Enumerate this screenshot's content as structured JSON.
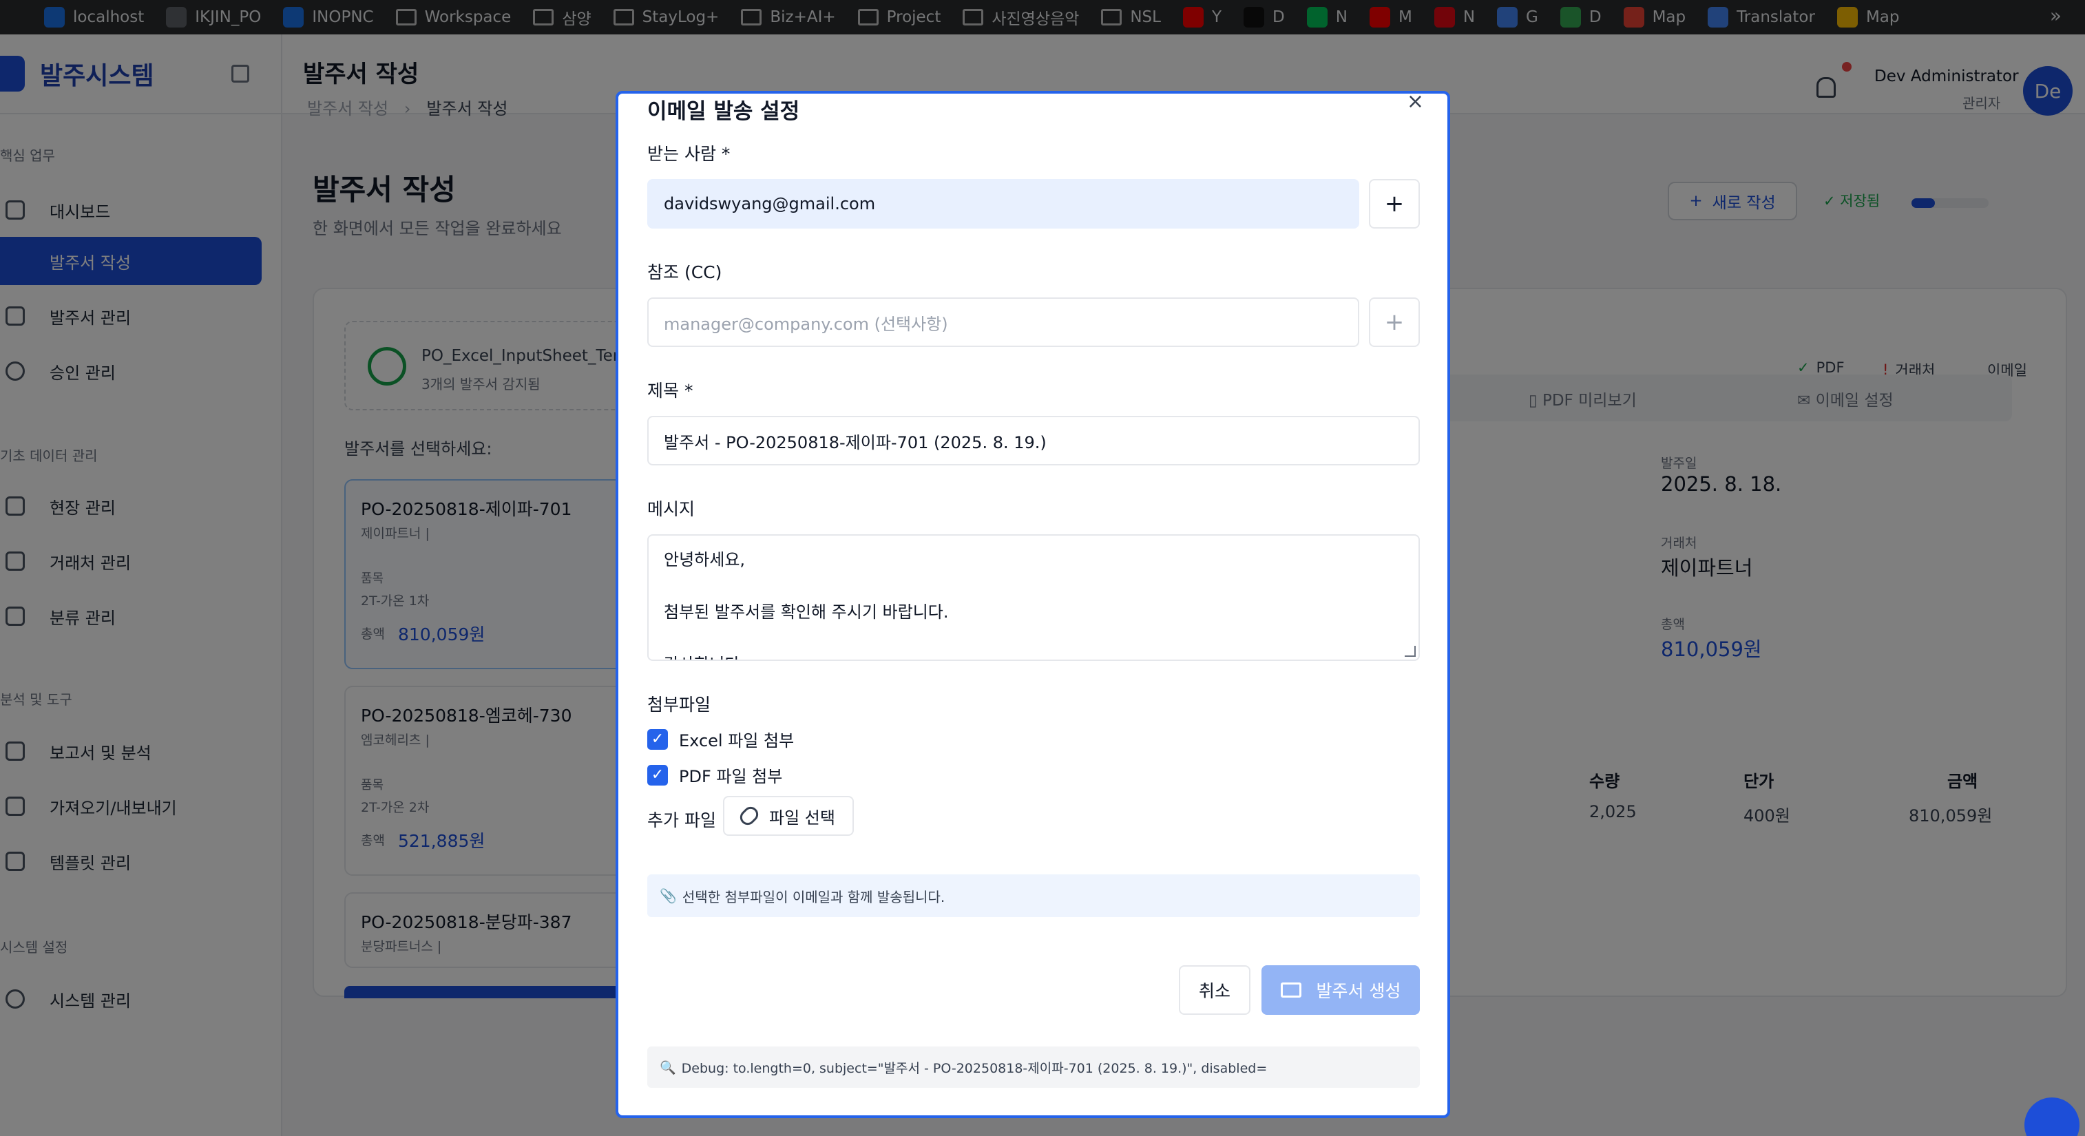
{
  "bookmarks": [
    {
      "label": "localhost",
      "icon": "globe-icon",
      "color": "#1a73e8"
    },
    {
      "label": "IKJIN_PO",
      "icon": "globe-icon",
      "color": "#5f6368"
    },
    {
      "label": "INOPNC",
      "icon": "globe-icon",
      "color": "#1a73e8"
    },
    {
      "label": "Workspace",
      "icon": "folder-icon"
    },
    {
      "label": "삼양",
      "icon": "folder-icon"
    },
    {
      "label": "StayLog+",
      "icon": "folder-icon"
    },
    {
      "label": "Biz+AI+",
      "icon": "folder-icon"
    },
    {
      "label": "Project",
      "icon": "folder-icon"
    },
    {
      "label": "사진영상음악",
      "icon": "folder-icon"
    },
    {
      "label": "NSL",
      "icon": "folder-icon"
    },
    {
      "label": "Y",
      "icon": "youtube-icon",
      "color": "#ff0000"
    },
    {
      "label": "D",
      "icon": "d-icon",
      "color": "#111111"
    },
    {
      "label": "N",
      "icon": "naver-icon",
      "color": "#03c75a"
    },
    {
      "label": "M",
      "icon": "youtube-music-icon",
      "color": "#ff0000"
    },
    {
      "label": "N",
      "icon": "netflix-icon",
      "color": "#e50914"
    },
    {
      "label": "G",
      "icon": "google-icon",
      "color": "#4285f4"
    },
    {
      "label": "D",
      "icon": "drive-icon",
      "color": "#34a853"
    },
    {
      "label": "Map",
      "icon": "google-maps-icon",
      "color": "#ea4335"
    },
    {
      "label": "Translator",
      "icon": "translate-icon",
      "color": "#4285f4"
    },
    {
      "label": "Map",
      "icon": "maps-icon",
      "color": "#fbbc04"
    }
  ],
  "bookmarks_more": "»",
  "sidebar": {
    "title": "발주시스템",
    "sections": [
      {
        "label": "핵심 업무",
        "top": 0
      },
      {
        "label": "기초 데이터 관리"
      },
      {
        "label": "분석 및 도구"
      },
      {
        "label": "시스템 설정"
      }
    ],
    "items": [
      {
        "label": "대시보드",
        "icon": "home-icon"
      },
      {
        "label": "발주서 작성",
        "icon": "plus-icon",
        "active": true
      },
      {
        "label": "발주서 관리",
        "icon": "document-icon"
      },
      {
        "label": "승인 관리",
        "icon": "check-circle-icon"
      },
      {
        "label": "현장 관리",
        "icon": "building-icon"
      },
      {
        "label": "거래처 관리",
        "icon": "building-2-icon"
      },
      {
        "label": "분류 관리",
        "icon": "tag-icon"
      },
      {
        "label": "보고서 및 분석",
        "icon": "bar-chart-icon"
      },
      {
        "label": "가져오기/내보내기",
        "icon": "file-import-icon"
      },
      {
        "label": "템플릿 관리",
        "icon": "template-icon"
      },
      {
        "label": "시스템 관리",
        "icon": "gear-icon"
      }
    ]
  },
  "header": {
    "title": "발주서 작성",
    "breadcrumb": [
      "발주서 작성",
      "발주서 작성"
    ],
    "breadcrumb_sep": "›",
    "user_name": "Dev Administrator",
    "user_role": "관리자",
    "avatar_initials": "De"
  },
  "page": {
    "title": "발주서 작성",
    "subtitle": "한 화면에서 모든 작업을 완료하세요",
    "new_button": "새로 작성",
    "saved_status": "저장됨",
    "progress_fraction": 0.3
  },
  "upload": {
    "file_name": "PO_Excel_InputSheet_Temp",
    "detected": "3개의 발주서 감지됨"
  },
  "po_list": {
    "label": "발주서를 선택하세요:",
    "items_label": "품목",
    "total_label": "총액",
    "items": [
      {
        "id": "PO-20250818-제이파-701",
        "vendor": "제이파트너 |",
        "item": "2T-가온 1차",
        "total": "810,059원",
        "selected": true
      },
      {
        "id": "PO-20250818-엠코헤-730",
        "vendor": "엠코헤리츠 |",
        "item": "2T-가온 2차",
        "total": "521,885원"
      },
      {
        "id": "PO-20250818-분당파-387",
        "vendor": "분당파트너스 |",
        "item": "",
        "total": ""
      }
    ]
  },
  "right_panel": {
    "badges": [
      {
        "label": "PDF",
        "icon": "check-circle-icon",
        "color": "#16a34a"
      },
      {
        "label": "거래처",
        "icon": "alert-circle-icon",
        "color": "#dc2626"
      },
      {
        "label": "이메일",
        "icon": "",
        "color": "#374151"
      }
    ],
    "tabs": [
      "PDF 미리보기",
      "이메일 설정"
    ],
    "order_date_label": "발주일",
    "order_date": "2025. 8. 18.",
    "vendor_label": "거래처",
    "vendor": "제이파트너",
    "total_label": "총액",
    "total": "810,059원",
    "table_headers": [
      "수량",
      "단가",
      "금액"
    ],
    "table_row": [
      "2,025",
      "400원",
      "810,059원"
    ]
  },
  "modal": {
    "title": "이메일 발송 설정",
    "close": "×",
    "to_label": "받는 사람 *",
    "to_value": "davidswyang@gmail.com",
    "cc_label": "참조 (CC)",
    "cc_placeholder": "manager@company.com (선택사항)",
    "add": "+",
    "subject_label": "제목 *",
    "subject_value": "발주서 - PO-20250818-제이파-701 (2025. 8. 19.)",
    "message_label": "메시지",
    "message_lines": [
      "안녕하세요,",
      "",
      "첨부된 발주서를 확인해 주시기 바랍니다.",
      "",
      "감사합니다."
    ],
    "attachments_label": "첨부파일",
    "attach_excel": "Excel 파일 첨부",
    "attach_pdf": "PDF 파일 첨부",
    "attach_excel_checked": true,
    "attach_pdf_checked": true,
    "extra_file_label": "추가 파일",
    "file_select": "파일 선택",
    "note_icon": "📎",
    "note": "선택한 첨부파일이 이메일과 함께 발송됩니다.",
    "cancel": "취소",
    "submit": "발주서 생성",
    "debug_icon": "🔍",
    "debug": "Debug: to.length=0, subject=\"발주서 - PO-20250818-제이파-701 (2025. 8. 19.)\", disabled="
  },
  "colors": {
    "primary": "#1d4ed8",
    "modal_border": "#2563eb",
    "submit_disabled": "#93b4f5"
  }
}
